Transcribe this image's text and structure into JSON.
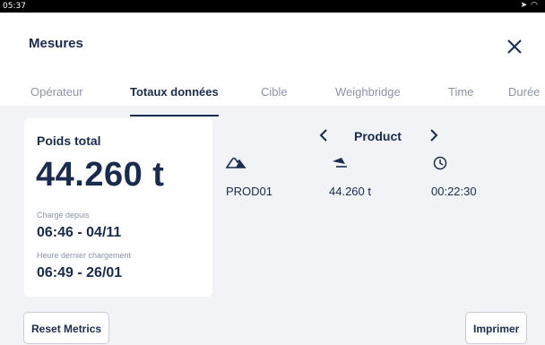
{
  "status": {
    "time": "05:37"
  },
  "header": {
    "title": "Mesures",
    "tabs": [
      {
        "label": "Opérateur",
        "active": false
      },
      {
        "label": "Totaux données",
        "active": true
      },
      {
        "label": "Cible",
        "active": false
      },
      {
        "label": "Weighbridge",
        "active": false
      },
      {
        "label": "Time",
        "active": false
      },
      {
        "label": "Durée",
        "active": false
      }
    ]
  },
  "summary": {
    "title": "Poids total",
    "total": "44.260 t",
    "loaded_since_label": "Chargé depuis",
    "loaded_since": "06:46 - 04/11",
    "last_load_label": "Heure dernier chargement",
    "last_load": "06:49 - 26/01"
  },
  "product": {
    "title": "Product",
    "name": "PROD01",
    "weight": "44.260 t",
    "duration": "00:22:30",
    "icons": [
      "pile-icon",
      "bucket-icon",
      "clock-icon"
    ]
  },
  "actions": {
    "reset": "Reset Metrics",
    "print": "Imprimer"
  }
}
